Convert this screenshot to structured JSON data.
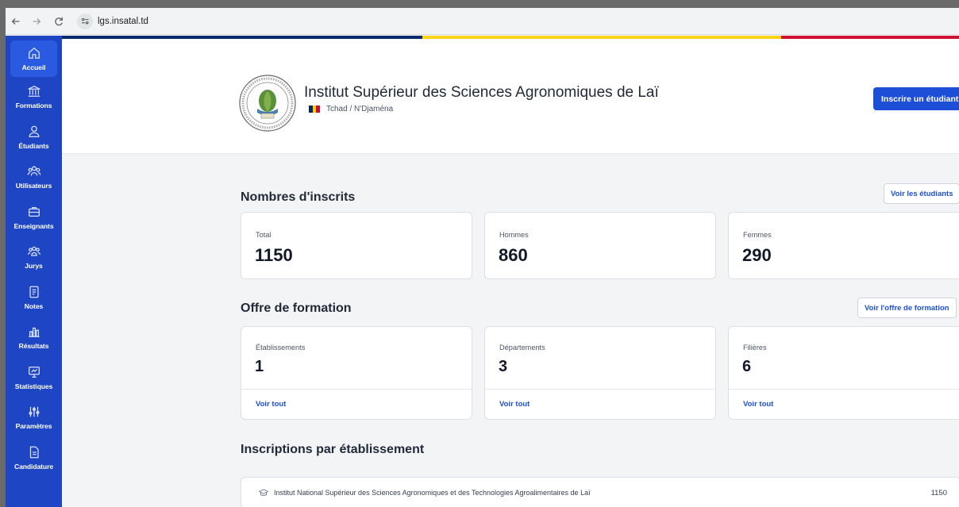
{
  "browser": {
    "url": "lgs.insatal.td"
  },
  "sidebar": {
    "items": [
      {
        "label": "Accueil",
        "icon": "home-icon",
        "active": true
      },
      {
        "label": "Formations",
        "icon": "institution-icon"
      },
      {
        "label": "Étudiants",
        "icon": "user-icon"
      },
      {
        "label": "Utilisateurs",
        "icon": "users-icon"
      },
      {
        "label": "Enseignants",
        "icon": "briefcase-icon"
      },
      {
        "label": "Jurys",
        "icon": "group-icon"
      },
      {
        "label": "Notes",
        "icon": "document-icon"
      },
      {
        "label": "Résultats",
        "icon": "bar-chart-icon"
      },
      {
        "label": "Statistiques",
        "icon": "presentation-chart-icon"
      },
      {
        "label": "Paramètres",
        "icon": "sliders-icon"
      },
      {
        "label": "Candidature",
        "icon": "file-icon"
      }
    ]
  },
  "colors": {
    "sidebar": "#1d45c4",
    "accent": "#1d4ed8",
    "flag_blue": "#002664",
    "flag_yellow": "#fecb00",
    "flag_red": "#c60c30"
  },
  "header": {
    "institution": "Institut Supérieur des Sciences Agronomiques de Laï",
    "location": "Tchad / N'Djaména",
    "enroll_button": "Inscrire un étudiant"
  },
  "enrollments": {
    "title": "Nombres d'inscrits",
    "view_button": "Voir les étudiants",
    "cards": [
      {
        "label": "Total",
        "value": "1150"
      },
      {
        "label": "Hommes",
        "value": "860"
      },
      {
        "label": "Femmes",
        "value": "290"
      }
    ]
  },
  "offer": {
    "title": "Offre de formation",
    "view_button": "Voir l'offre de formation",
    "cards": [
      {
        "label": "Établissements",
        "value": "1",
        "link": "Voir tout"
      },
      {
        "label": "Départements",
        "value": "3",
        "link": "Voir tout"
      },
      {
        "label": "Filières",
        "value": "6",
        "link": "Voir tout"
      }
    ]
  },
  "by_establishment": {
    "title": "Inscriptions par établissement",
    "rows": [
      {
        "name": "Institut National Supérieur des Sciences Agronomiques et des Technologies Agroalimentaires de Laï",
        "count": "1150"
      }
    ]
  }
}
